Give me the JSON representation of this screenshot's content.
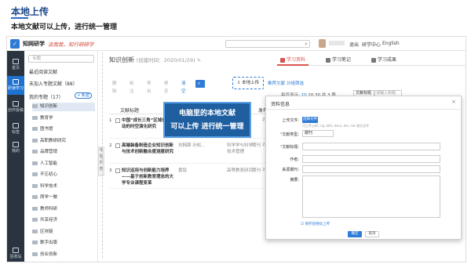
{
  "slide": {
    "title": "本地上传",
    "subtitle": "本地文献可以上传，进行统一管理"
  },
  "app": {
    "logo_glyph": "✓",
    "name": "知网研学",
    "slogan": "汲哉哉，知行研研学",
    "nav": [
      "退出",
      "研学中心",
      "English"
    ]
  },
  "rail": [
    {
      "label": "首页",
      "active": false
    },
    {
      "label": "研读学习",
      "active": true
    },
    {
      "label": "创作投稿",
      "active": false
    },
    {
      "label": "标签",
      "active": false
    },
    {
      "label": "我的",
      "active": false
    },
    {
      "label": "回收站",
      "active": false
    }
  ],
  "sidebar": {
    "search_placeholder": "专题",
    "recent": "最近阅读文献",
    "unfiled": "未加入专题文献（88）",
    "my_topics": "我的专题（17）",
    "new_label": "+ 新建",
    "folders": [
      "知识创新",
      "教育学",
      "图书馆",
      "高职教研研究",
      "品牌营销",
      "人工智能",
      "不忘初心",
      "科学技术",
      "两学一做",
      "教师科研",
      "共享经济",
      "区块链",
      "数字出版",
      "创业创新"
    ],
    "collapse": "专题列表"
  },
  "main": {
    "title": "知识创新",
    "date": "(创建时间：2020/01/29)",
    "tabs": [
      "学习资料",
      "学习笔记",
      "学习成果"
    ],
    "toolbar": [
      "删除",
      "标注",
      "导出",
      "移至",
      "清空"
    ],
    "search_add": "检索添加",
    "local_upload": "本地上传",
    "recommend": "推荐文献",
    "filter": "分组筛选",
    "page_label": "每页显示:",
    "page_sizes": [
      "10",
      "20",
      "30"
    ],
    "total": "共 3 篇",
    "sort": "文献标题",
    "kw_placeholder": "请输入标题",
    "columns": [
      "文献标题",
      "作者",
      "发布日期"
    ],
    "rows": [
      {
        "idx": "1",
        "title": "中国“成长三角”区域创新驱动的时空演化研究",
        "author": "",
        "source": "",
        "type": "",
        "year": "2016"
      },
      {
        "idx": "2",
        "title": "高端装备制造企业知识创新与技术创新融合度测度研究",
        "author": "刘韩颐 孙松...",
        "source": "科学学与科学技术管理",
        "type": "期刊",
        "year": "2016"
      },
      {
        "idx": "3",
        "title": "知识运用与创新能力培养——基于创新教育理念的大学专业课程变革",
        "author": "黄铭",
        "source": "高等教育研究",
        "type": "期刊",
        "year": "2016"
      }
    ]
  },
  "callout": {
    "line1": "电脑里的本地文献",
    "line2": "可以上传 进行统一管理"
  },
  "dialog": {
    "title": "资料信息",
    "close": "×",
    "file_label": "上传文件:",
    "pick_button": "选择文件",
    "file_hint": "可上传.pdf,.caj,.kdh,.docx,.doc,.txt 格式文件",
    "type_label": "文献类型:",
    "type_value": "期刊",
    "name_label": "文献标题:",
    "author_label": "作者:",
    "source_label": "来源期刊:",
    "abstract_label": "摘要:",
    "keep_check": "保存后继续上传",
    "ok": "确定",
    "cancel": "取消"
  }
}
